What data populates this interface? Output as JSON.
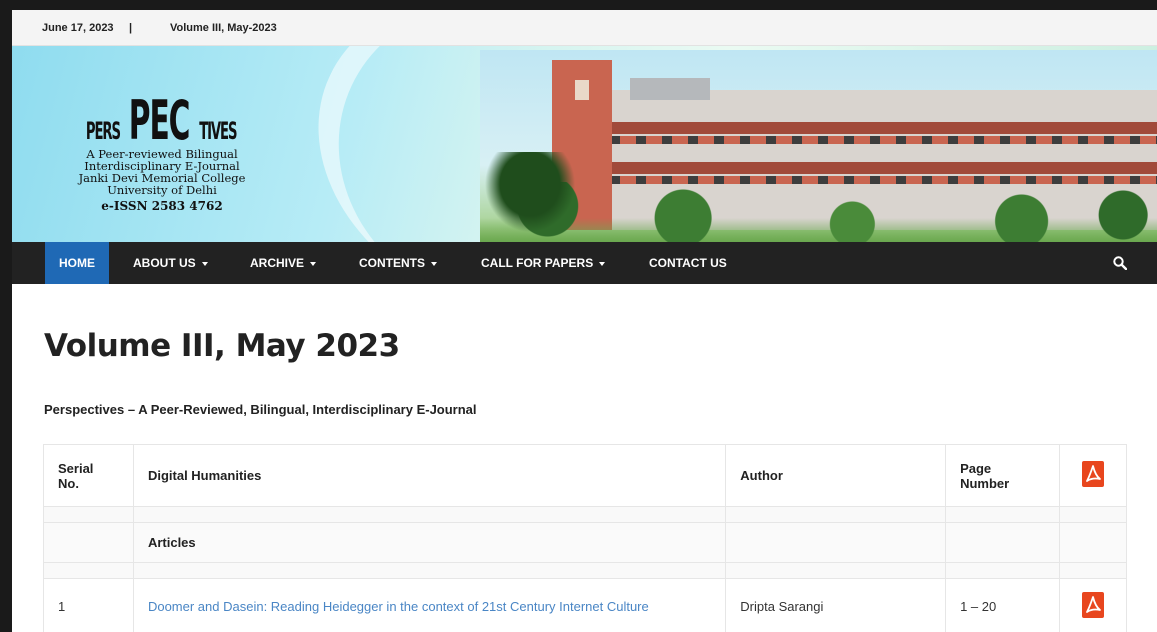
{
  "topbar": {
    "date": "June 17, 2023",
    "separator": "|",
    "current_issue": "Volume III, May-2023"
  },
  "logo": {
    "word_small_left": "PERS",
    "word_large": "PEC",
    "word_small_right": "TIVES",
    "tagline1": "A Peer-reviewed Bilingual",
    "tagline2": "Interdisciplinary E-Journal",
    "college": "Janki Devi Memorial College",
    "university": "University of Delhi",
    "issn": "e-ISSN 2583 4762"
  },
  "nav": {
    "items": [
      {
        "label": "HOME",
        "active": true
      },
      {
        "label": "ABOUT US",
        "dropdown": true
      },
      {
        "label": "ARCHIVE",
        "dropdown": true
      },
      {
        "label": "CONTENTS",
        "dropdown": true
      },
      {
        "label": "CALL FOR PAPERS",
        "dropdown": true
      },
      {
        "label": "CONTACT US"
      }
    ],
    "search_icon": "search-icon"
  },
  "page": {
    "title": "Volume III, May 2023",
    "subtitle": "Perspectives – A Peer-Reviewed, Bilingual, Interdisciplinary E-Journal"
  },
  "table": {
    "headers": {
      "serial_line1": "Serial",
      "serial_line2": "No.",
      "section": "Digital Humanities",
      "author": "Author",
      "page_line1": "Page",
      "page_line2": "Number",
      "pdf_icon": "pdf-icon"
    },
    "section_label": "Articles",
    "rows": [
      {
        "serial": "1",
        "title": "Doomer and Dasein: Reading Heidegger in the context of 21st Century Internet Culture",
        "author": "Dripta Sarangi",
        "pages": "1 – 20",
        "pdf_icon": "pdf-icon"
      }
    ]
  },
  "colors": {
    "nav_bg": "#222222",
    "nav_active": "#1f69b5",
    "link": "#4a86c5",
    "pdf_red": "#e8461e"
  }
}
